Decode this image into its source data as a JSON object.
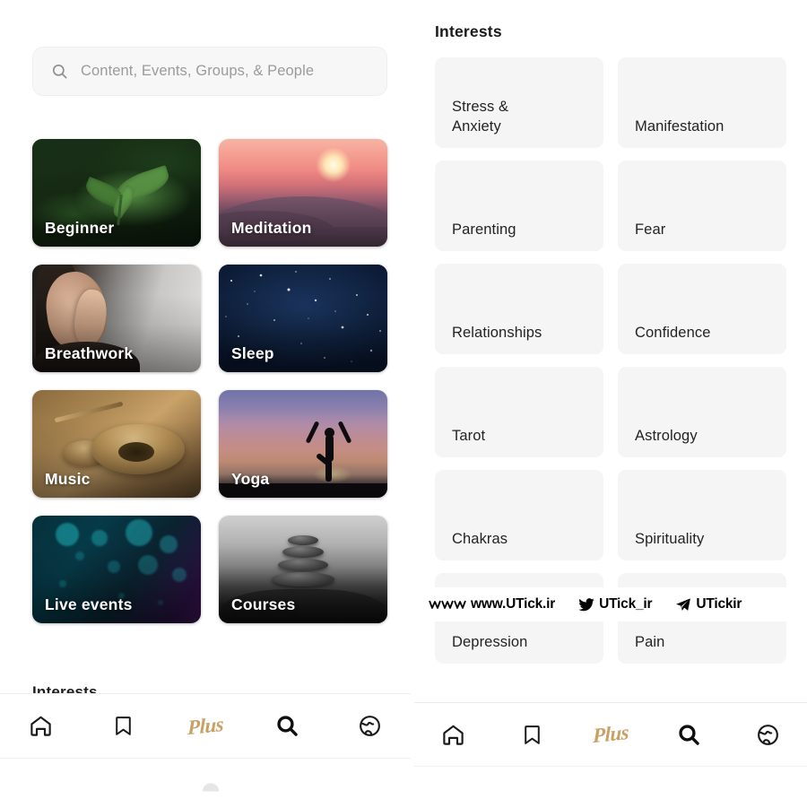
{
  "search": {
    "placeholder": "Content, Events, Groups, & People",
    "value": "",
    "icon": "search-icon"
  },
  "categories": {
    "cards": [
      {
        "label": "Beginner",
        "art": "art-beginner"
      },
      {
        "label": "Meditation",
        "art": "art-meditation"
      },
      {
        "label": "Breathwork",
        "art": "art-breathwork"
      },
      {
        "label": "Sleep",
        "art": "art-sleep"
      },
      {
        "label": "Music",
        "art": "art-music"
      },
      {
        "label": "Yoga",
        "art": "art-yoga"
      },
      {
        "label": "Live events",
        "art": "art-live"
      },
      {
        "label": "Courses",
        "art": "art-courses"
      }
    ]
  },
  "left_panel": {
    "interests_heading": "Interests"
  },
  "right_panel": {
    "heading": "Interests",
    "interests": [
      "Stress &\nAnxiety",
      "Manifestation",
      "Parenting",
      "Fear",
      "Relationships",
      "Confidence",
      "Tarot",
      "Astrology",
      "Chakras",
      "Spirituality",
      "Depression",
      "Pain"
    ]
  },
  "watermark": {
    "items": [
      {
        "icon": "www-icon",
        "label": "www.UTick.ir"
      },
      {
        "icon": "twitter-icon",
        "label": "UTick_ir"
      },
      {
        "icon": "telegram-icon",
        "label": "UTickir"
      }
    ]
  },
  "bottom_nav": {
    "items": [
      {
        "name": "home",
        "icon": "home-icon",
        "label": ""
      },
      {
        "name": "bookmark",
        "icon": "bookmark-icon",
        "label": ""
      },
      {
        "name": "plus",
        "icon": "plus-text",
        "label": "Plus"
      },
      {
        "name": "search",
        "icon": "search-icon",
        "label": ""
      },
      {
        "name": "discover",
        "icon": "globe-icon",
        "label": ""
      }
    ]
  },
  "colors": {
    "accent_gold": "#c9a063",
    "tile_bg": "#f5f5f5",
    "search_bg": "#f7f7f7",
    "text_primary": "#1e1e1e",
    "text_placeholder": "#9b9b9b"
  }
}
